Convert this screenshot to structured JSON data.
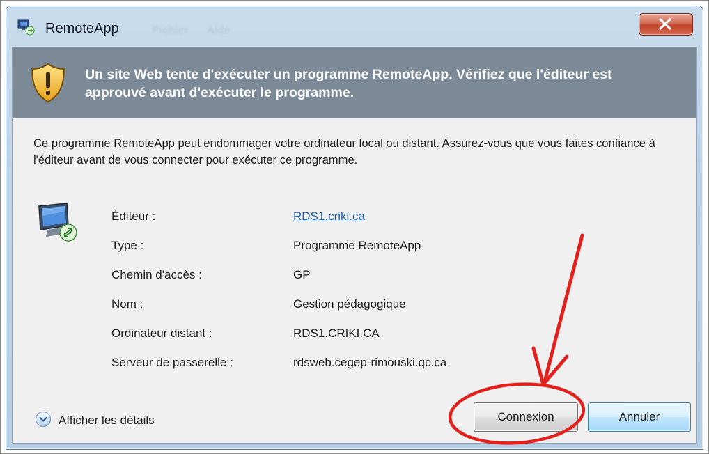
{
  "window": {
    "title": "RemoteApp",
    "ghost_menu": [
      "Fichier",
      "Aide"
    ]
  },
  "banner": {
    "text": "Un site Web tente d'exécuter un programme RemoteApp. Vérifiez que l'éditeur est approuvé avant d'exécuter le programme."
  },
  "description": "Ce programme RemoteApp peut endommager votre ordinateur local ou distant. Assurez-vous que vous faites confiance à l'éditeur avant de vous connecter pour exécuter ce programme.",
  "properties": [
    {
      "label": "Éditeur :",
      "value": "RDS1.criki.ca"
    },
    {
      "label": "Type :",
      "value": "Programme RemoteApp"
    },
    {
      "label": "Chemin d'accès :",
      "value": "GP"
    },
    {
      "label": "Nom :",
      "value": "Gestion pédagogique"
    },
    {
      "label": "Ordinateur distant :",
      "value": "RDS1.CRIKI.CA"
    },
    {
      "label": "Serveur de passerelle :",
      "value": "rdsweb.cegep-rimouski.qc.ca"
    }
  ],
  "footer": {
    "details_label": "Afficher les détails",
    "connect_label": "Connexion",
    "cancel_label": "Annuler"
  },
  "icons": {
    "app": "remoteapp-icon",
    "close": "close-icon",
    "shield": "warning-shield-icon",
    "computer": "remote-computer-icon",
    "details": "chevron-down-circle-icon"
  },
  "colors": {
    "banner_bg": "#7c8a98",
    "link": "#1a5fb0",
    "annotation": "#e3211c",
    "close_button": "#c0432b"
  }
}
